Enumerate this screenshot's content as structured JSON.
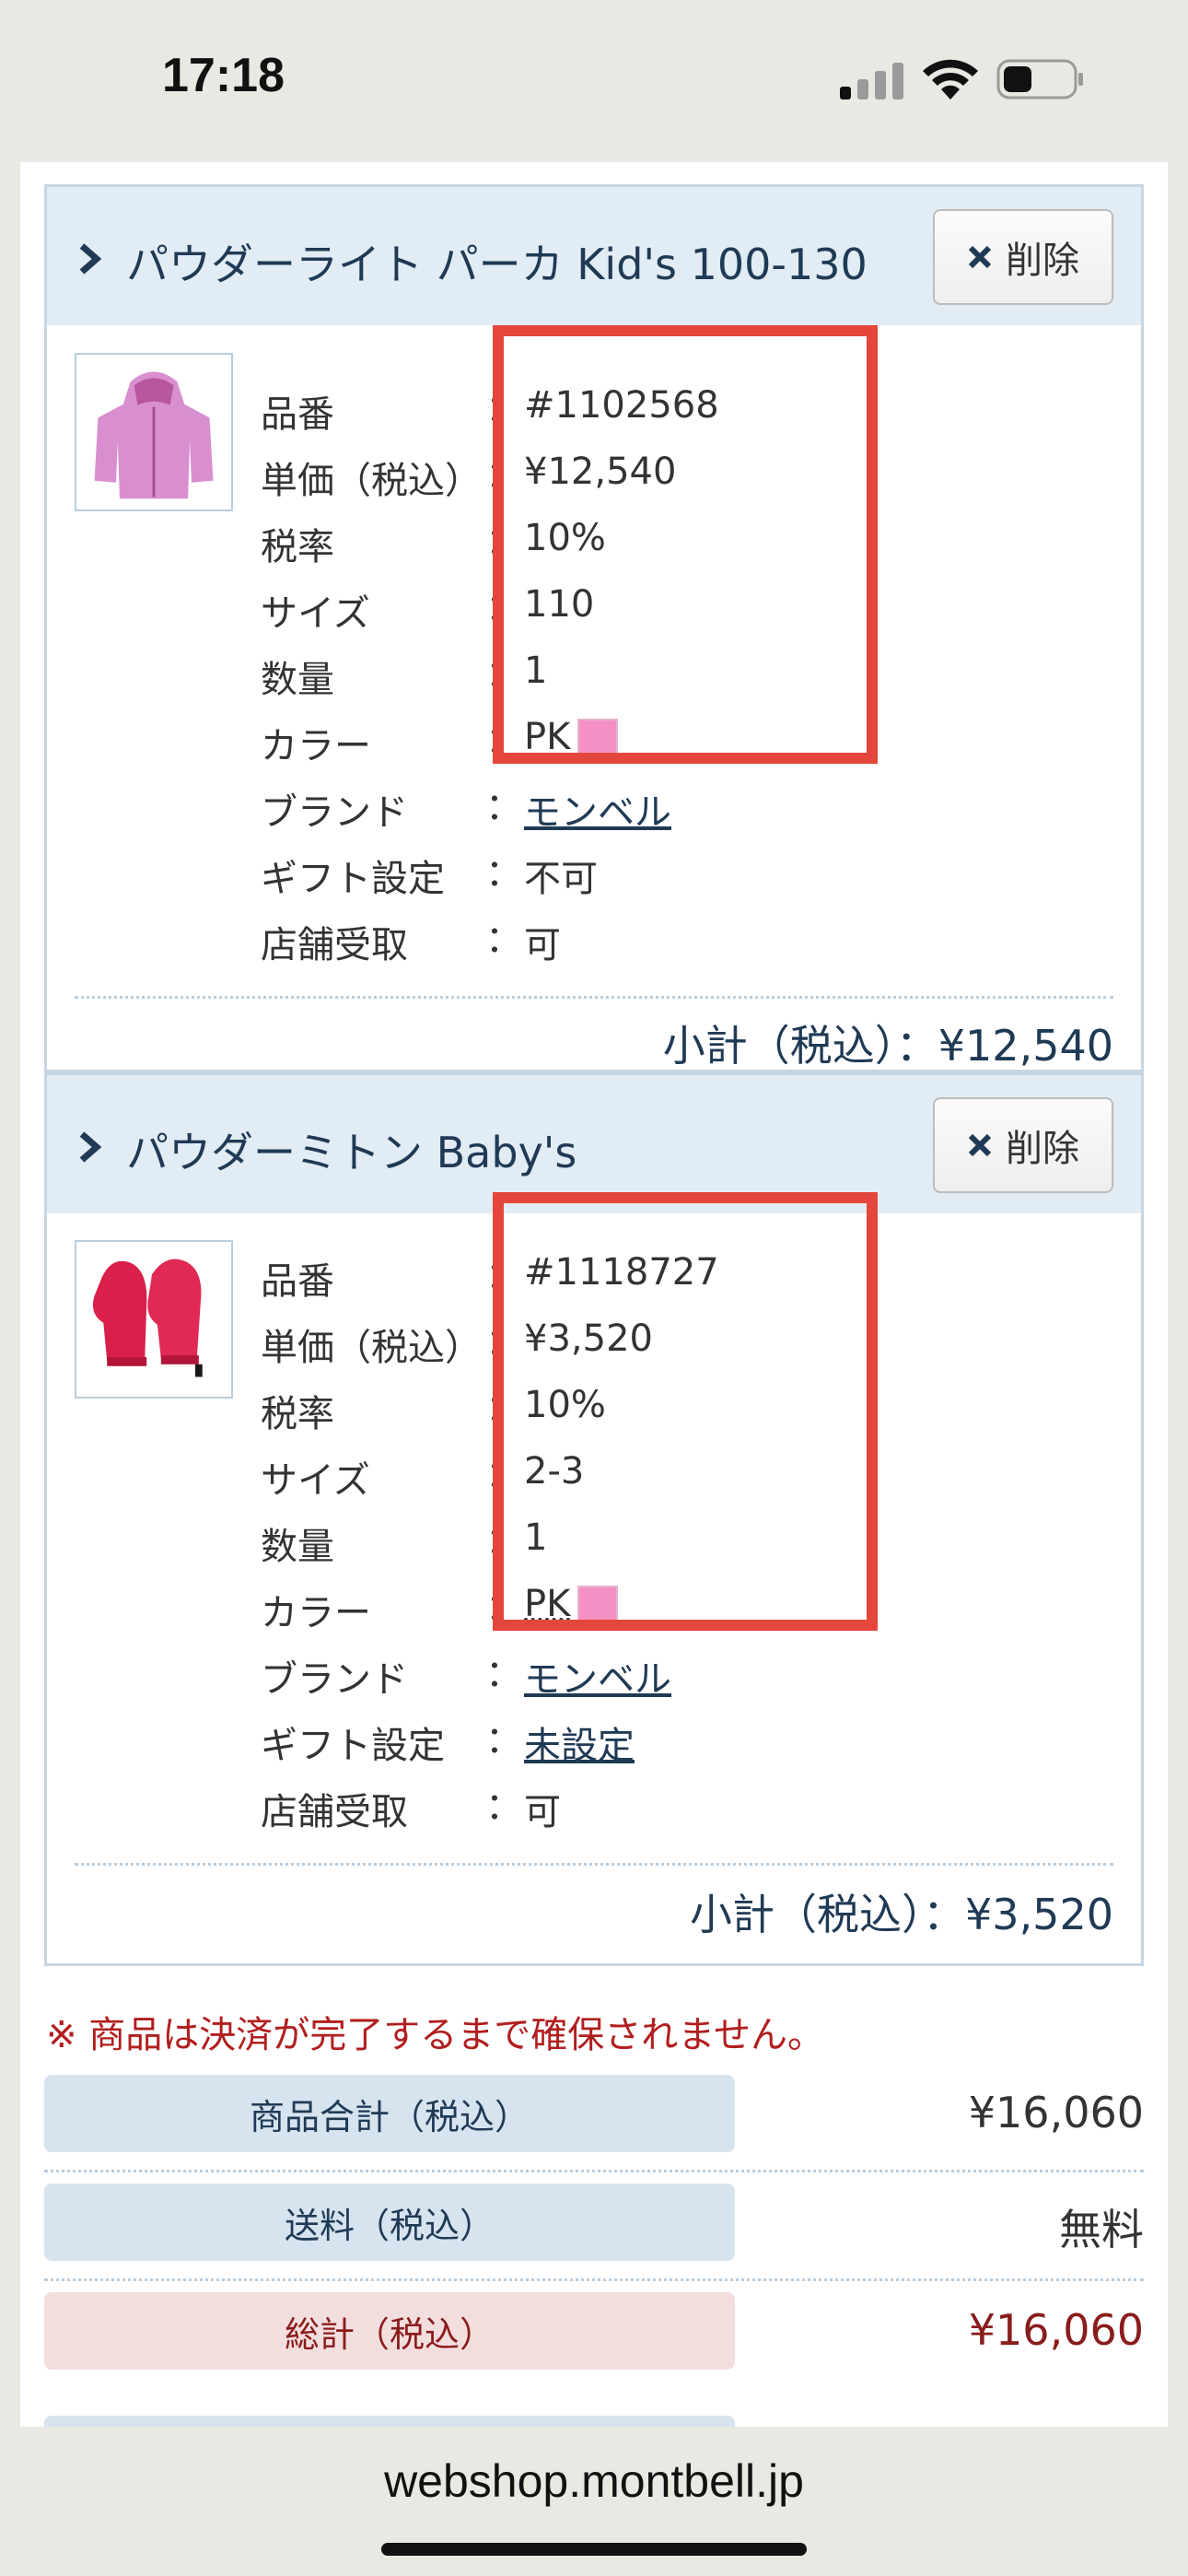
{
  "status_bar": {
    "time": "17:18"
  },
  "items": [
    {
      "title": "パウダーライト パーカ Kid's 100-130",
      "delete_label": "削除",
      "specs": [
        {
          "label": "品番",
          "value": "#1102568"
        },
        {
          "label": "単価（税込）",
          "value": "¥12,540"
        },
        {
          "label": "税率",
          "value": "10%"
        },
        {
          "label": "サイズ",
          "value": "110"
        },
        {
          "label": "数量",
          "value": "1"
        },
        {
          "label": "カラー",
          "value": "PK"
        },
        {
          "label": "ブランド",
          "value": "モンベル"
        },
        {
          "label": "ギフト設定",
          "value": "不可"
        },
        {
          "label": "店舗受取",
          "value": "可"
        }
      ],
      "subtotal": "小計（税込）：¥12,540",
      "color_hex": "#f490c4"
    },
    {
      "title": "パウダーミトン Baby's",
      "delete_label": "削除",
      "specs": [
        {
          "label": "品番",
          "value": "#1118727"
        },
        {
          "label": "単価（税込）",
          "value": "¥3,520"
        },
        {
          "label": "税率",
          "value": "10%"
        },
        {
          "label": "サイズ",
          "value": "2-3"
        },
        {
          "label": "数量",
          "value": "1"
        },
        {
          "label": "カラー",
          "value": "PK"
        },
        {
          "label": "ブランド",
          "value": "モンベル"
        },
        {
          "label": "ギフト設定",
          "value": "未設定"
        },
        {
          "label": "店舗受取",
          "value": "可"
        }
      ],
      "subtotal": "小計（税込）：¥3,520",
      "color_hex": "#f490c4"
    }
  ],
  "colon": "：",
  "notice": "※ 商品は決済が完了するまで確保されません。",
  "summary": {
    "goods_total_label": "商品合計（税込）",
    "goods_total_value": "¥16,060",
    "shipping_label": "送料（税込）",
    "shipping_value": "無料",
    "grand_total_label": "総計（税込）",
    "grand_total_value": "¥16,060"
  },
  "url": "webshop.montbell.jp",
  "colors": {
    "header_bg": "#e1ecf4",
    "highlight": "#e5463c",
    "accent_text": "#1f3a55",
    "total_red": "#8a1c1c"
  }
}
